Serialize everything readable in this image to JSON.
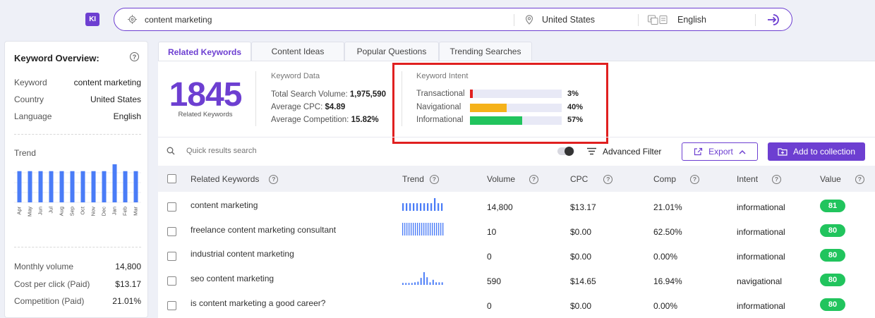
{
  "app": {
    "logo_text": "KI"
  },
  "search": {
    "query": "content marketing",
    "country": "United States",
    "language": "English"
  },
  "left_panel": {
    "title": "Keyword Overview:",
    "rows": [
      {
        "key": "Keyword",
        "value": "content marketing"
      },
      {
        "key": "Country",
        "value": "United States"
      },
      {
        "key": "Language",
        "value": "English"
      }
    ],
    "trend_label": "Trend",
    "chart_data": {
      "type": "bar",
      "categories": [
        "Apr",
        "May",
        "Jun",
        "Jul",
        "Aug",
        "Sep",
        "Oct",
        "Nov",
        "Dec",
        "Jan",
        "Feb",
        "Mar"
      ],
      "values": [
        0.82,
        0.82,
        0.82,
        0.82,
        0.82,
        0.82,
        0.82,
        0.82,
        0.82,
        1.0,
        0.82,
        0.82
      ],
      "bar_color": "#4a7cf7",
      "grid": true
    },
    "stats": [
      {
        "key": "Monthly volume",
        "value": "14,800"
      },
      {
        "key": "Cost per click (Paid)",
        "value": "$13.17"
      },
      {
        "key": "Competition (Paid)",
        "value": "21.01%"
      }
    ]
  },
  "tabs": [
    {
      "label": "Related Keywords",
      "active": true
    },
    {
      "label": "Content Ideas",
      "active": false
    },
    {
      "label": "Popular Questions",
      "active": false
    },
    {
      "label": "Trending Searches",
      "active": false
    }
  ],
  "summary": {
    "count": "1845",
    "count_label": "Related Keywords",
    "keyword_data_title": "Keyword Data",
    "total_volume_label": "Total Search Volume:",
    "total_volume": "1,975,590",
    "avg_cpc_label": "Average CPC:",
    "avg_cpc": "$4.89",
    "avg_comp_label": "Average Competition:",
    "avg_comp": "15.82%",
    "intent_title": "Keyword Intent",
    "intent": [
      {
        "label": "Transactional",
        "pct": "3%",
        "fraction": 0.03,
        "color": "#e02020"
      },
      {
        "label": "Navigational",
        "pct": "40%",
        "fraction": 0.4,
        "color": "#f5b21a"
      },
      {
        "label": "Informational",
        "pct": "57%",
        "fraction": 0.57,
        "color": "#21c45d"
      }
    ]
  },
  "toolbar": {
    "search_placeholder": "Quick results search",
    "advanced_filter": "Advanced Filter",
    "export": "Export",
    "add_to_collection": "Add to collection"
  },
  "table": {
    "headers": {
      "keyword": "Related Keywords",
      "trend": "Trend",
      "volume": "Volume",
      "cpc": "CPC",
      "comp": "Comp",
      "intent": "Intent",
      "value": "Value"
    },
    "rows": [
      {
        "keyword": "content marketing",
        "trend": [
          0.6,
          0.6,
          0.6,
          0.6,
          0.6,
          0.6,
          0.6,
          0.6,
          0.6,
          1.0,
          0.6,
          0.6
        ],
        "volume": "14,800",
        "cpc": "$13.17",
        "comp": "21.01%",
        "intent": "informational",
        "value": "81"
      },
      {
        "keyword": "freelance content marketing consultant",
        "trend": [
          1,
          1,
          1,
          1,
          1,
          1,
          1,
          1,
          1,
          1,
          1,
          1,
          1,
          1,
          1,
          1,
          1,
          1,
          1,
          1
        ],
        "volume": "10",
        "cpc": "$0.00",
        "comp": "62.50%",
        "intent": "informational",
        "value": "80"
      },
      {
        "keyword": "industrial content marketing",
        "trend": [],
        "volume": "0",
        "cpc": "$0.00",
        "comp": "0.00%",
        "intent": "informational",
        "value": "80"
      },
      {
        "keyword": "seo content marketing",
        "trend": [
          0.15,
          0.15,
          0.15,
          0.15,
          0.2,
          0.25,
          0.55,
          1.0,
          0.6,
          0.2,
          0.4,
          0.2,
          0.2,
          0.2
        ],
        "volume": "590",
        "cpc": "$14.65",
        "comp": "16.94%",
        "intent": "navigational",
        "value": "80"
      },
      {
        "keyword": "is content marketing a good career?",
        "trend": [],
        "volume": "0",
        "cpc": "$0.00",
        "comp": "0.00%",
        "intent": "informational",
        "value": "80"
      }
    ]
  },
  "colors": {
    "accent": "#6d3fd1",
    "value_pill": "#21c45d",
    "spark": "#4a7cf7"
  }
}
